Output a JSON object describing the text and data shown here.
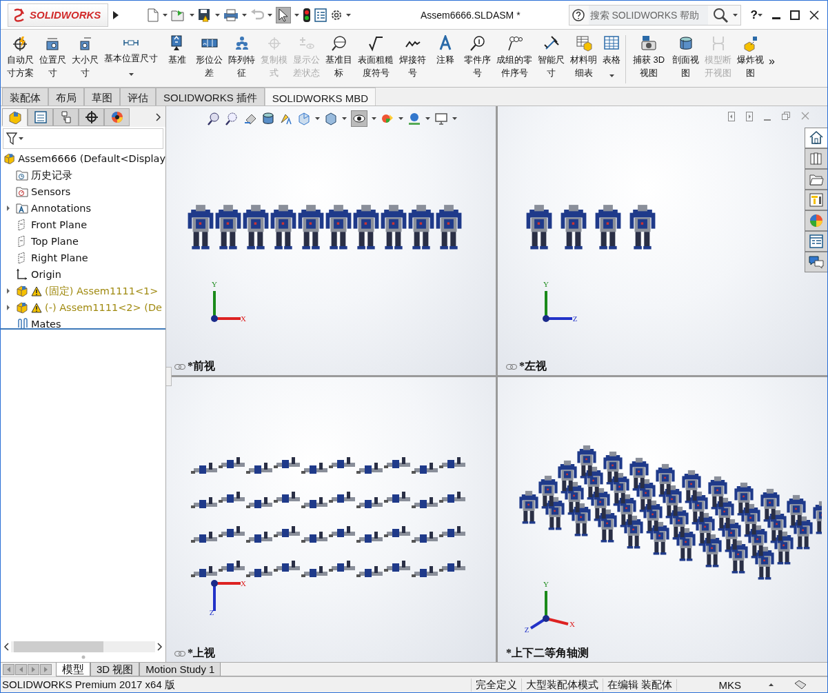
{
  "window": {
    "logo": "SOLIDWORKS",
    "title": "Assem6666.SLDASM *",
    "search": {
      "placeholder": "搜索 SOLIDWORKS 帮助"
    },
    "help": "?"
  },
  "ribbon": {
    "items": [
      {
        "label": "自动尺寸方案",
        "kind": "large",
        "disabled": false
      },
      {
        "label": "位置尺寸",
        "kind": "large",
        "disabled": false
      },
      {
        "label": "大小尺寸",
        "kind": "large",
        "disabled": false
      },
      {
        "label": "基本位置尺寸",
        "kind": "dropdown",
        "disabled": false
      },
      {
        "label": "基准",
        "kind": "large",
        "disabled": false
      },
      {
        "label": "形位公差",
        "kind": "large",
        "disabled": false
      },
      {
        "label": "阵列特征",
        "kind": "large",
        "disabled": false
      },
      {
        "label": "复制模式",
        "kind": "large",
        "disabled": true
      },
      {
        "label": "显示公差状态",
        "kind": "large",
        "disabled": true
      },
      {
        "label": "基准目标",
        "kind": "large",
        "disabled": false
      },
      {
        "label": "表面粗糙度符号",
        "kind": "large",
        "disabled": false
      },
      {
        "label": "焊接符号",
        "kind": "large",
        "disabled": false
      },
      {
        "label": "注释",
        "kind": "large",
        "disabled": false
      },
      {
        "label": "零件序号",
        "kind": "large",
        "disabled": false
      },
      {
        "label": "成组的零件序号",
        "kind": "large",
        "disabled": false
      },
      {
        "label": "智能尺寸",
        "kind": "large",
        "disabled": false
      },
      {
        "label": "材料明细表",
        "kind": "large",
        "disabled": false
      },
      {
        "label": "表格",
        "kind": "dropdown",
        "disabled": false
      },
      {
        "label": "捕获 3D 视图",
        "kind": "large",
        "disabled": false
      },
      {
        "label": "剖面视图",
        "kind": "large",
        "disabled": false
      },
      {
        "label": "模型断开视图",
        "kind": "large",
        "disabled": true
      },
      {
        "label": "爆炸视图",
        "kind": "large",
        "disabled": false
      }
    ],
    "overflow": "»"
  },
  "command_tabs": [
    {
      "label": "装配体",
      "selected": false
    },
    {
      "label": "布局",
      "selected": false
    },
    {
      "label": "草图",
      "selected": false
    },
    {
      "label": "评估",
      "selected": false
    },
    {
      "label": "SOLIDWORKS 插件",
      "selected": false
    },
    {
      "label": "SOLIDWORKS MBD",
      "selected": true
    }
  ],
  "feature_manager": {
    "tabs": [
      {
        "selected": true
      },
      {
        "selected": false
      },
      {
        "selected": false
      },
      {
        "selected": false
      },
      {
        "selected": false
      }
    ],
    "tree": {
      "label": "Assem6666  (Default<Display",
      "children": [
        {
          "label": "历史记录",
          "kind": "history",
          "warning": false
        },
        {
          "label": "Sensors",
          "kind": "sensors",
          "warning": false
        },
        {
          "label": "Annotations",
          "kind": "annotations",
          "expanded": false,
          "warning": false
        },
        {
          "label": "Front Plane",
          "kind": "plane",
          "warning": false
        },
        {
          "label": "Top Plane",
          "kind": "plane",
          "warning": false
        },
        {
          "label": "Right Plane",
          "kind": "plane",
          "warning": false
        },
        {
          "label": "Origin",
          "kind": "origin",
          "warning": false
        },
        {
          "label": "(固定) Assem1111<1>",
          "kind": "component",
          "expanded": false,
          "warning": true
        },
        {
          "label": "(-) Assem1111<2> (De",
          "kind": "component",
          "expanded": false,
          "warning": true
        },
        {
          "label": "Mates",
          "kind": "mates",
          "warning": false
        }
      ]
    }
  },
  "viewport": {
    "panes": [
      {
        "label": "*前视",
        "linked": true,
        "axes": [
          {
            "label": "Y"
          },
          {
            "label": "X"
          }
        ]
      },
      {
        "label": "*左视",
        "linked": true,
        "axes": [
          {
            "label": "Y"
          },
          {
            "label": "Z"
          }
        ]
      },
      {
        "label": "*上视",
        "linked": true,
        "axes": [
          {
            "label": "X"
          },
          {
            "label": "Z"
          }
        ]
      },
      {
        "label": "*上下二等角轴测",
        "linked": false,
        "axes": [
          {
            "label": "Y"
          },
          {
            "label": "X"
          },
          {
            "label": "Z"
          }
        ]
      }
    ]
  },
  "task_pane": [
    {
      "selected": true
    },
    {
      "selected": false
    },
    {
      "selected": false
    },
    {
      "selected": false
    },
    {
      "selected": false
    },
    {
      "selected": false
    },
    {
      "selected": false
    }
  ],
  "bottom_tabs": [
    {
      "label": "模型",
      "selected": true
    },
    {
      "label": "3D 视图",
      "selected": false
    },
    {
      "label": "Motion Study 1",
      "selected": false
    }
  ],
  "status_bar": {
    "product": "SOLIDWORKS Premium 2017 x64 版",
    "fields": [
      "完全定义",
      "大型装配体模式",
      "在编辑 装配体",
      "MKS"
    ]
  }
}
